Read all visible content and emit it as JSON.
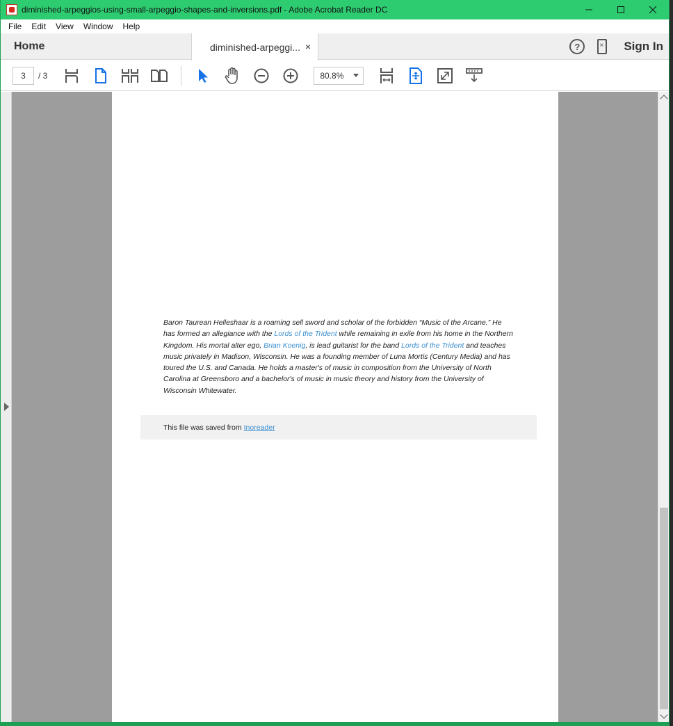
{
  "window": {
    "title": "diminished-arpeggios-using-small-arpeggio-shapes-and-inversions.pdf - Adobe Acrobat Reader DC",
    "accent_color": "#2ecc71"
  },
  "menu": {
    "items": [
      {
        "label": "File"
      },
      {
        "label": "Edit"
      },
      {
        "label": "View"
      },
      {
        "label": "Window"
      },
      {
        "label": "Help"
      }
    ]
  },
  "tabs": {
    "home_label": "Home",
    "doc_label": "diminished-arpeggi...",
    "close_glyph": "×",
    "signin_label": "Sign In",
    "help_glyph": "?"
  },
  "toolbar": {
    "current_page": "3",
    "page_total": "/ 3",
    "zoom": "80.8%"
  },
  "document": {
    "bio_parts": [
      {
        "text": "Baron Taurean Helleshaar is a roaming sell sword and scholar of the forbidden “Music of the Arcane.” He has formed an allegiance with the ",
        "link": false
      },
      {
        "text": "Lords of the Trident",
        "link": true
      },
      {
        "text": " while remaining in exile from his home in the Northern Kingdom. His mortal alter ego, ",
        "link": false
      },
      {
        "text": "Brian Koenig",
        "link": true
      },
      {
        "text": ", is lead guitarist for the band ",
        "link": false
      },
      {
        "text": "Lords of the Trident",
        "link": true
      },
      {
        "text": " and teaches music privately in Madison, Wisconsin. He was a founding member of Luna Mortis (Century Media) and has toured the U.S. and Canada. He holds a master's of music in composition from the University of North Carolina at Greensboro and a bachelor's of music in music theory and history from the University of Wisconsin Whitewater.",
        "link": false
      }
    ],
    "saved_text": "This file was saved from",
    "saved_link": "Inoreader",
    "link_color": "#3b8fd1"
  }
}
